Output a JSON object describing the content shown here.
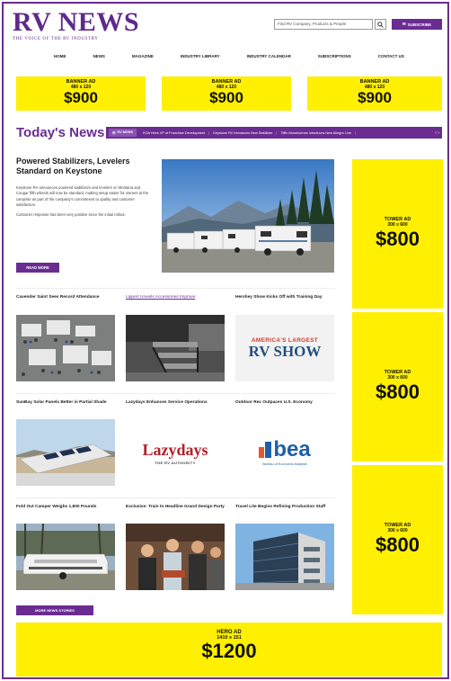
{
  "header": {
    "logo_main": "RV NEWS",
    "logo_sub": "THE VOICE OF THE RV INDUSTRY",
    "search_placeholder": "Find RV Company, Products & People",
    "subscribe_label": "SUBSCRIBE"
  },
  "nav": [
    "HOME",
    "NEWS",
    "MAGAZINE",
    "INDUSTRY LIBRARY",
    "INDUSTRY CALENDAR",
    "SUBSCRIPTIONS",
    "CONTACT US"
  ],
  "banner_ads": [
    {
      "label": "BANNER AD",
      "size": "480 x 120",
      "price": "$900"
    },
    {
      "label": "BANNER AD",
      "size": "480 x 120",
      "price": "$900"
    },
    {
      "label": "BANNER AD",
      "size": "480 x 120",
      "price": "$900"
    }
  ],
  "today": {
    "title": "Today's News",
    "badge": "RV NEWS",
    "ticker_items": [
      "KOA Hires VP of Franchise Development",
      "Keystone RV Introduces New Stabilizer",
      "Tiffin Motorhomes Introduces New Allegro Line"
    ],
    "arrows": "‹ ›"
  },
  "featured": {
    "title": "Powered Stabilizers, Levelers Standard on Keystone",
    "body_1": "Keystone RV announces powered stabilizers and levelers on Montana and Cougar fifth wheels will now be standard, making setup easier for owners at the campsite as part of the company's commitment to quality and customer satisfaction.",
    "body_2": "Customer response has been very positive since the initial rollout.",
    "read_more": "READ MORE"
  },
  "tower_ads": [
    {
      "label": "TOWER AD",
      "size": "300 x 600",
      "price": "$800"
    },
    {
      "label": "TOWER AD",
      "size": "300 x 600",
      "price": "$800"
    },
    {
      "label": "TOWER AD",
      "size": "300 x 600",
      "price": "$800"
    }
  ],
  "grid": [
    {
      "title": "Cavender Saint Sees Record Attendance"
    },
    {
      "title": "Lippert Unveils Accessories Improve"
    },
    {
      "title": "Hershey Show Kicks Off with Training Day"
    },
    {
      "title": "SunBay Solar Panels Better in Partial Shade"
    },
    {
      "title": "Lazydays Enhances Service Operations"
    },
    {
      "title": "Outdoor Rec Outpaces U.S. Economy"
    },
    {
      "title": "Fold Out Camper Weighs 1,800 Pounds"
    },
    {
      "title": "Exclusive: Train to Headline Grand Design Party"
    },
    {
      "title": "Travel Lite Begins Refining Production Staff"
    }
  ],
  "logos": {
    "show_top": "AMERICA'S LARGEST",
    "show_main": "RV SHOW",
    "lazydays_main": "Lazydays",
    "lazydays_sub": "THE RV AUTHORITY",
    "bea_main": "bea",
    "bea_sub": "Bureau of Economic Analysis"
  },
  "more_news_label": "MORE NEWS STORIES",
  "hero_ad": {
    "label": "HERO AD",
    "size": "1410 x 151",
    "price": "$1200"
  },
  "colors": {
    "brand_purple": "#6a2c91",
    "ad_yellow": "#ffef00"
  }
}
